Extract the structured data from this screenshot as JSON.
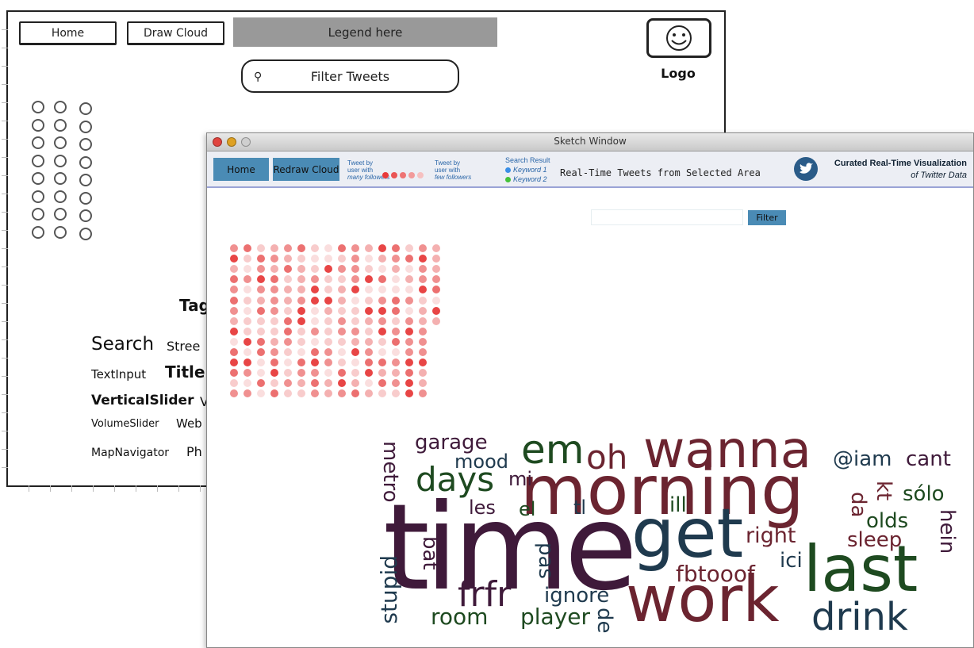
{
  "mockup": {
    "home_label": "Home",
    "draw_cloud_label": "Draw Cloud",
    "legend_label": "Legend here",
    "filter_label": "Filter Tweets",
    "logo_label": "Logo",
    "tag_heading": "Tag",
    "tags": [
      "Search",
      "Stree",
      "TextInput",
      "Title",
      "VerticalSlider",
      "V",
      "VolumeSlider",
      "Web",
      "MapNavigator",
      "Ph"
    ]
  },
  "window": {
    "title": "Sketch Window",
    "toolbar": {
      "home_label": "Home",
      "redraw_label": "Redraw Cloud",
      "legend_many": [
        "Tweet by",
        "user with",
        "many followers"
      ],
      "legend_few": [
        "Tweet by",
        "user with",
        "few followers"
      ],
      "search_result_label": "Search Result",
      "keyword1": "Keyword 1",
      "keyword2": "Keyword 2",
      "realtime_title": "Real-Time Tweets from Selected Area",
      "brand_line1": "Curated Real-Time Visualization",
      "brand_line2": "of Twitter Data"
    },
    "search": {
      "value": "",
      "placeholder": "",
      "filter_label": "Filter"
    },
    "colors": {
      "button": "#4a8bb5",
      "keyword1": "#3a8ee6",
      "keyword2": "#44c23a",
      "dot": "#e84545"
    },
    "words": [
      "time",
      "morning",
      "wanna",
      "get",
      "last",
      "work",
      "em",
      "oh",
      "days",
      "drink",
      "frfr",
      "garage",
      "metro",
      "mood",
      "mi",
      "les",
      "el",
      "tl",
      "ill",
      "right",
      "ici",
      "fbtooof",
      "pas",
      "bat",
      "stupid",
      "room",
      "player",
      "ignore",
      "de",
      "@iam",
      "cant",
      "kt",
      "da",
      "sólo",
      "olds",
      "sleep",
      "hein"
    ]
  }
}
